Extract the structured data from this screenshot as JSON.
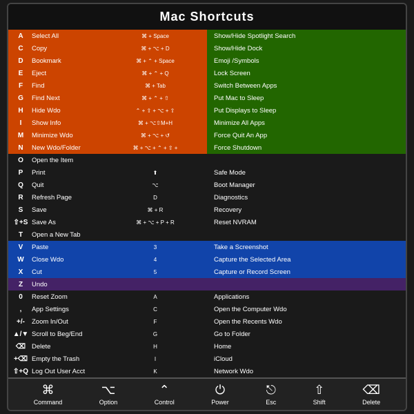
{
  "title": "Mac Shortcuts",
  "left_rows": [
    {
      "key": "A",
      "action": "Select All",
      "bg": "orange"
    },
    {
      "key": "C",
      "action": "Copy",
      "bg": "orange"
    },
    {
      "key": "D",
      "action": "Bookmark",
      "bg": "orange"
    },
    {
      "key": "E",
      "action": "Eject",
      "bg": "orange"
    },
    {
      "key": "F",
      "action": "Find",
      "bg": "orange"
    },
    {
      "key": "G",
      "action": "Find Next",
      "bg": "orange"
    },
    {
      "key": "H",
      "action": "Hide Wdo",
      "bg": "orange"
    },
    {
      "key": "I",
      "action": "Show Info",
      "bg": "orange"
    },
    {
      "key": "M",
      "action": "Minimize Wdo",
      "bg": "orange"
    },
    {
      "key": "N",
      "action": "New Wdo/Folder",
      "bg": "orange"
    },
    {
      "key": "O",
      "action": "Open the Item",
      "bg": "dark"
    },
    {
      "key": "P",
      "action": "Print",
      "bg": "dark"
    },
    {
      "key": "Q",
      "action": "Quit",
      "bg": "dark"
    },
    {
      "key": "R",
      "action": "Refresh Page",
      "bg": "dark"
    },
    {
      "key": "S",
      "action": "Save",
      "bg": "dark"
    },
    {
      "key": "⇧+S",
      "action": "Save As",
      "bg": "dark"
    },
    {
      "key": "T",
      "action": "Open a New Tab",
      "bg": "dark"
    },
    {
      "key": "V",
      "action": "Paste",
      "bg": "dark"
    },
    {
      "key": "W",
      "action": "Close Wdo",
      "bg": "dark"
    },
    {
      "key": "X",
      "action": "Cut",
      "bg": "dark"
    },
    {
      "key": "Z",
      "action": "Undo",
      "bg": "dark"
    },
    {
      "key": "0",
      "action": "Reset Zoom",
      "bg": "dark"
    },
    {
      "key": ",",
      "action": "App Settings",
      "bg": "dark"
    },
    {
      "key": "+/-",
      "action": "Zoom In/Out",
      "bg": "dark"
    },
    {
      "key": "▲/▼",
      "action": "Scroll to Beg/End",
      "bg": "dark"
    },
    {
      "key": "⌫",
      "action": "Delete",
      "bg": "dark"
    },
    {
      "key": "+⌫",
      "action": "Empty the Trash",
      "bg": "dark"
    },
    {
      "key": "⇧+Q",
      "action": "Log Out User Acct",
      "bg": "dark"
    }
  ],
  "left_shortcuts": [
    {
      "shortcut": "⌘ + Space",
      "bg": "orange"
    },
    {
      "shortcut": "⌘ + ⌥ + D",
      "bg": "orange"
    },
    {
      "shortcut": "⌘ + ⌃ + Space",
      "bg": "orange"
    },
    {
      "shortcut": "⌘ + ⌃ + Q",
      "bg": "orange"
    },
    {
      "shortcut": "⌘ + Tab",
      "bg": "orange"
    },
    {
      "shortcut": "⌘ + ⌃ + ⇧",
      "bg": "orange"
    },
    {
      "shortcut": "⌃ + ⇧ + ⌥ + ⇧",
      "bg": "orange"
    },
    {
      "shortcut": "⌘ + ⌥ + ⇧ + M + H",
      "bg": "orange"
    },
    {
      "shortcut": "⌘ + ⌥ + ↺",
      "bg": "orange"
    },
    {
      "shortcut": "⌘ + ⌥ + ⌃ + ⇧ + ⬆",
      "bg": "orange"
    },
    {
      "shortcut": "",
      "bg": "dark"
    },
    {
      "shortcut": "⬆",
      "bg": "dark"
    },
    {
      "shortcut": "⌥",
      "bg": "dark"
    },
    {
      "shortcut": "D",
      "bg": "dark"
    },
    {
      "shortcut": "⌘ + R",
      "bg": "dark"
    },
    {
      "shortcut": "⌘ + ⌥ + P + R",
      "bg": "dark"
    },
    {
      "shortcut": "",
      "bg": "dark"
    },
    {
      "shortcut": "3",
      "bg": "dark"
    },
    {
      "shortcut": "4",
      "bg": "dark"
    },
    {
      "shortcut": "5",
      "bg": "dark"
    },
    {
      "shortcut": "",
      "bg": "dark"
    },
    {
      "shortcut": "A",
      "bg": "dark"
    },
    {
      "shortcut": "C",
      "bg": "dark"
    },
    {
      "shortcut": "F",
      "bg": "dark"
    },
    {
      "shortcut": "G",
      "bg": "dark"
    },
    {
      "shortcut": "H",
      "bg": "dark"
    },
    {
      "shortcut": "I",
      "bg": "dark"
    },
    {
      "shortcut": "K",
      "bg": "dark"
    }
  ],
  "right_rows": [
    {
      "shortcut": "Show/Hide Spotlight Search",
      "bg": "green"
    },
    {
      "shortcut": "Show/Hide  Dock",
      "bg": "green"
    },
    {
      "shortcut": "Emoji /Symbols",
      "bg": "green"
    },
    {
      "shortcut": "Lock Screen",
      "bg": "green"
    },
    {
      "shortcut": "Switch Between Apps",
      "bg": "green"
    },
    {
      "shortcut": "Put Mac to Sleep",
      "bg": "green"
    },
    {
      "shortcut": "Put Displays to Sleep",
      "bg": "green"
    },
    {
      "shortcut": "Minimize All Apps",
      "bg": "green"
    },
    {
      "shortcut": "Force Quit An App",
      "bg": "green"
    },
    {
      "shortcut": "Force  Shutdown",
      "bg": "green"
    },
    {
      "shortcut": "",
      "bg": "dark"
    },
    {
      "shortcut": "Safe Mode",
      "bg": "dark"
    },
    {
      "shortcut": "Boot Manager",
      "bg": "dark"
    },
    {
      "shortcut": "Diagnostics",
      "bg": "dark"
    },
    {
      "shortcut": "Recovery",
      "bg": "dark"
    },
    {
      "shortcut": "Reset NVRAM",
      "bg": "dark"
    },
    {
      "shortcut": "",
      "bg": "dark"
    },
    {
      "shortcut": "Take a Screenshot",
      "bg": "blue"
    },
    {
      "shortcut": "Capture the Selected Area",
      "bg": "blue"
    },
    {
      "shortcut": "Capture or Record Screen",
      "bg": "blue"
    },
    {
      "shortcut": "",
      "bg": "purple"
    },
    {
      "shortcut": "Applications",
      "bg": "dark"
    },
    {
      "shortcut": "Open the Computer Wdo",
      "bg": "dark"
    },
    {
      "shortcut": "Open the Recents Wdo",
      "bg": "dark"
    },
    {
      "shortcut": "Go to Folder",
      "bg": "dark"
    },
    {
      "shortcut": "Home",
      "bg": "dark"
    },
    {
      "shortcut": "iCloud",
      "bg": "dark"
    },
    {
      "shortcut": "Network Wdo",
      "bg": "dark"
    }
  ],
  "footer": {
    "items": [
      {
        "icon": "⌘",
        "label": "Command"
      },
      {
        "icon": "⌥",
        "label": "Option"
      },
      {
        "icon": "⌃",
        "label": "Control"
      },
      {
        "icon": "⏻",
        "label": "Power"
      },
      {
        "icon": "⎋",
        "label": "Esc"
      },
      {
        "icon": "⇧",
        "label": "Shift"
      },
      {
        "icon": "⌫",
        "label": "Delete"
      }
    ]
  }
}
